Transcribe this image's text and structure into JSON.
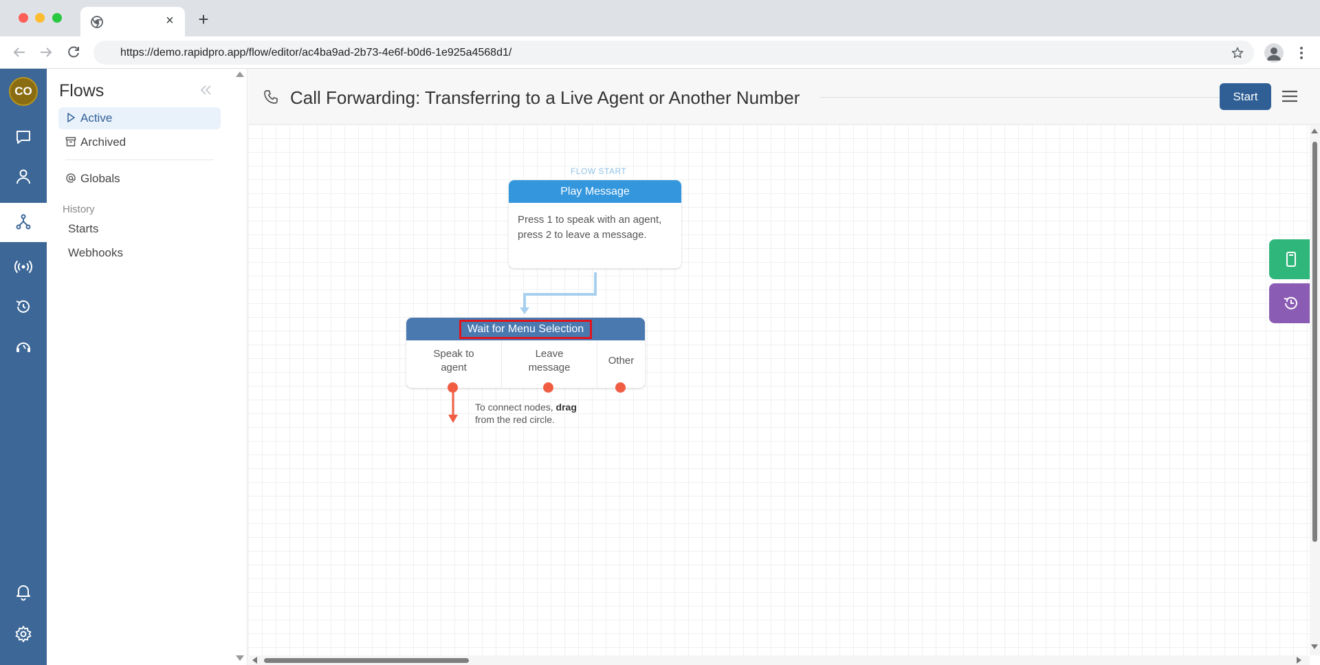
{
  "browser": {
    "url": "https://demo.rapidpro.app/flow/editor/ac4ba9ad-2b73-4e6f-b0d6-1e925a4568d1/"
  },
  "rail": {
    "avatar_initials": "CO"
  },
  "sidebar": {
    "title": "Flows",
    "items": [
      {
        "label": "Active"
      },
      {
        "label": "Archived"
      },
      {
        "label": "Globals"
      }
    ],
    "history_label": "History",
    "history_items": [
      {
        "label": "Starts"
      },
      {
        "label": "Webhooks"
      }
    ]
  },
  "header": {
    "title": "Call Forwarding: Transferring to a Live Agent or Another Number",
    "start_label": "Start"
  },
  "canvas": {
    "flow_start_label": "FLOW START",
    "play_node": {
      "title": "Play Message",
      "body": "Press 1 to speak with an agent, press 2 to leave a message."
    },
    "wait_node": {
      "title": "Wait for Menu Selection",
      "exits": [
        {
          "line1": "Speak to",
          "line2": "agent"
        },
        {
          "line1": "Leave",
          "line2": "message"
        },
        {
          "line1": "Other",
          "line2": ""
        }
      ]
    },
    "hint": {
      "prefix": "To connect nodes, ",
      "bold": "drag",
      "suffix": "from the red circle."
    }
  },
  "colors": {
    "rail": "#3c6797",
    "play_header": "#3497dd",
    "wait_header": "#4a79b0",
    "exit_dot": "#f05d43",
    "highlight": "#e0141c",
    "side_green": "#2fb67a",
    "side_purple": "#8b5cb3"
  }
}
